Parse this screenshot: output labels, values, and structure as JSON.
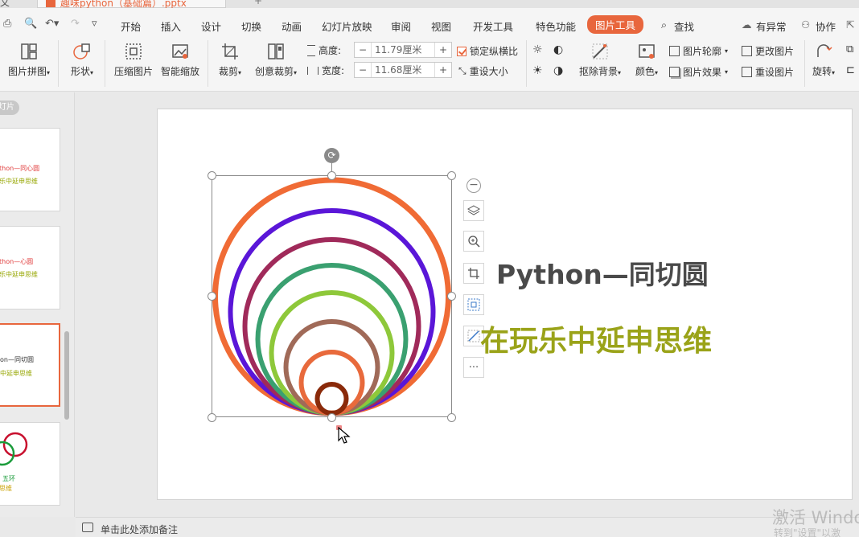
{
  "title_tab": {
    "left_fragment": "文",
    "doc_title": "趣味python（基础篇）.pptx"
  },
  "menu": {
    "items": [
      "开始",
      "插入",
      "设计",
      "切换",
      "动画",
      "幻灯片放映",
      "审阅",
      "视图",
      "开发工具",
      "特色功能"
    ],
    "active": "图片工具",
    "search": "查找",
    "right": [
      "有异常",
      "协作"
    ]
  },
  "ribbon": {
    "picture_collage": "图片拼图",
    "shape": "形状",
    "compress": "压缩图片",
    "smart_scale": "智能缩放",
    "crop": "裁剪",
    "creative_crop": "创意裁剪",
    "height_label": "高度:",
    "height_value": "11.79厘米",
    "width_label": "宽度:",
    "width_value": "11.68厘米",
    "lock_ratio": "锁定纵横比",
    "reset_size": "重设大小",
    "remove_bg": "抠除背景",
    "color": "颜色",
    "pic_outline": "图片轮廓",
    "pic_effect": "图片效果",
    "change_pic": "更改图片",
    "reset_pic": "重设图片",
    "rotate": "旋转"
  },
  "slides_panel": {
    "header_fragment": "灯片",
    "thumbnails": [
      {
        "line1": "thon—同心圆",
        "line2": "乐中延申思维"
      },
      {
        "line1": "thon—心圆",
        "line2": "乐中延申思维"
      },
      {
        "line1": "on—同切圆",
        "line2": "中延申思维"
      },
      {
        "line1": "五环",
        "line2": "思维"
      }
    ]
  },
  "slide": {
    "title": "Python—同切圆",
    "subtitle": "在玩乐中延申思维",
    "circle_colors": [
      "#f06b35",
      "#5a16d8",
      "#a02a5a",
      "#3aa070",
      "#8ec83a",
      "#a06a58",
      "#e86a3c",
      "#8a2a0a"
    ]
  },
  "notes": {
    "placeholder": "单击此处添加备注"
  },
  "watermark": {
    "line1": "激活 Windo",
    "line2": "转到\"设置\"以激"
  }
}
